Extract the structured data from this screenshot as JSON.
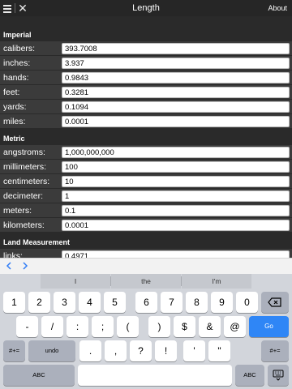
{
  "title_bar": {
    "title": "Length",
    "about_label": "About",
    "menu_icon": "hamburger-menu-icon",
    "close_icon": "close-icon"
  },
  "sections": {
    "imperial": {
      "header": "Imperial",
      "rows": [
        {
          "label": "calibers:",
          "value": "393.7008"
        },
        {
          "label": "inches:",
          "value": "3.937"
        },
        {
          "label": "hands:",
          "value": "0.9843"
        },
        {
          "label": "feet:",
          "value": "0.3281"
        },
        {
          "label": "yards:",
          "value": "0.1094"
        },
        {
          "label": "miles:",
          "value": "0.0001"
        }
      ]
    },
    "metric": {
      "header": "Metric",
      "rows": [
        {
          "label": "angstroms:",
          "value": "1,000,000,000"
        },
        {
          "label": "millimeters:",
          "value": "100"
        },
        {
          "label": "centimeters:",
          "value": "10"
        },
        {
          "label": "decimeter:",
          "value": "1"
        },
        {
          "label": "meters:",
          "value": "0.1"
        },
        {
          "label": "kilometers:",
          "value": "0.0001"
        }
      ]
    },
    "land": {
      "header": "Land Measurement",
      "rows": [
        {
          "label": "links:",
          "value": "0.4971"
        }
      ]
    }
  },
  "accessory_bar": {
    "prev_icon": "chevron-left-icon",
    "next_icon": "chevron-right-icon"
  },
  "keyboard": {
    "suggestions": [
      "I",
      "the",
      "I'm"
    ],
    "row1": [
      "1",
      "2",
      "3",
      "4",
      "5",
      "6",
      "7",
      "8",
      "9",
      "0"
    ],
    "row2": [
      "-",
      "/",
      ":",
      ";",
      "(",
      ")",
      "$",
      "&",
      "@"
    ],
    "row3": [
      ".",
      ",",
      "?",
      "!",
      "'",
      "\""
    ],
    "backspace_icon": "backspace-icon",
    "go_label": "Go",
    "symbols_label": "#+=",
    "undo_label": "undo",
    "abc_label": "ABC",
    "dismiss_icon": "keyboard-dismiss-icon",
    "accent_color": "#2f86f6"
  }
}
